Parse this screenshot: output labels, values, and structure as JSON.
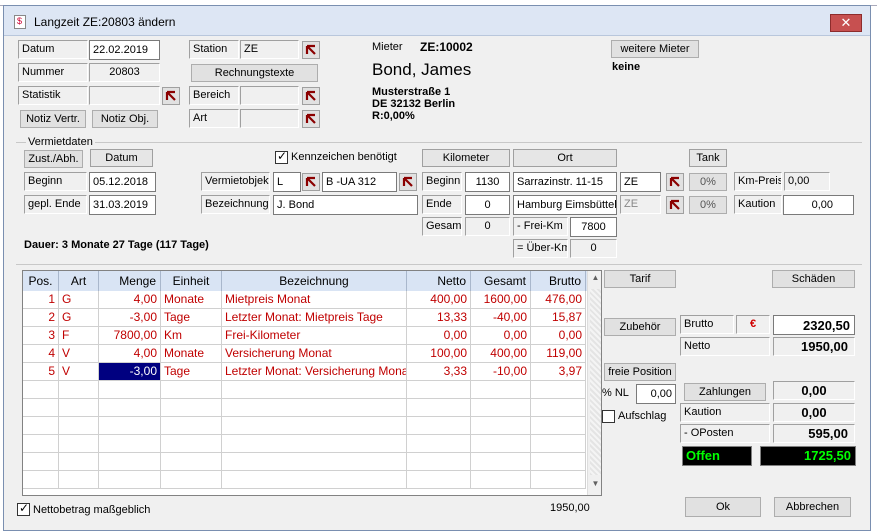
{
  "window": {
    "title": "Langzeit ZE:20803 ändern",
    "close_label": "✕"
  },
  "header": {
    "datum_label": "Datum",
    "datum_value": "22.02.2019",
    "nummer_label": "Nummer",
    "nummer_value": "20803",
    "statistik_label": "Statistik",
    "statistik_value": "",
    "notiz_vertr": "Notiz Vertr.",
    "notiz_obj": "Notiz Obj.",
    "station_label": "Station",
    "station_value": "ZE",
    "rechnungstexte": "Rechnungstexte",
    "bereich_label": "Bereich",
    "bereich_value": "",
    "art_label": "Art",
    "art_value": "",
    "mieter_label": "Mieter",
    "mieter_id": "ZE:10002",
    "mieter_name": "Bond, James",
    "addr1": "Musterstraße 1",
    "addr2": "DE 32132 Berlin",
    "addr3": "R:0,00%",
    "weitere_mieter": "weitere Mieter",
    "weitere_value": "keine"
  },
  "vermietdaten": {
    "title": "Vermietdaten",
    "zust_abh": "Zust./Abh.",
    "datum_hdr": "Datum",
    "beginn_label": "Beginn",
    "beginn_value": "05.12.2018",
    "gepl_ende_label": "gepl. Ende",
    "gepl_ende_value": "31.03.2019",
    "kennzeichen": "Kennzeichen benötigt",
    "vermietobjekt_label": "Vermietobjekt",
    "vo_type": "L",
    "vo_value": "B -UA 312",
    "bezeichnung_label": "Bezeichnung",
    "bezeichnung_value": "J. Bond",
    "km_hdr": "Kilometer",
    "ort_hdr": "Ort",
    "tank_hdr": "Tank",
    "km_beginn_label": "Beginn",
    "km_beginn": "1130",
    "ort_beginn": "Sarrazinstr. 11-15",
    "ort_beginn_code": "ZE",
    "tank_beginn": "0%",
    "km_ende_label": "Ende",
    "km_ende": "0",
    "ort_ende": "Hamburg Eimsbüttel",
    "ort_ende_code": "ZE",
    "tank_ende": "0%",
    "gesamt_label": "Gesamt",
    "gesamt_value": "0",
    "frei_km_label": "- Frei-Km",
    "frei_km_value": "7800",
    "ueber_km_label": "= Über-Km",
    "ueber_km_value": "0",
    "km_preis_label": "Km-Preis",
    "km_preis_value": "0,00",
    "kaution_label": "Kaution",
    "kaution_value": "0,00",
    "dauer": "Dauer: 3 Monate 27 Tage  (117 Tage)"
  },
  "grid": {
    "columns": [
      "Pos.",
      "Art",
      "Menge",
      "Einheit",
      "Bezeichnung",
      "Netto",
      "Gesamt",
      "Brutto"
    ],
    "rows": [
      [
        "1",
        "G",
        "4,00",
        "Monate",
        "Mietpreis Monat",
        "400,00",
        "1600,00",
        "476,00"
      ],
      [
        "2",
        "G",
        "-3,00",
        "Tage",
        "Letzter Monat: Mietpreis Tage",
        "13,33",
        "-40,00",
        "15,87"
      ],
      [
        "3",
        "F",
        "7800,00",
        "Km",
        "Frei-Kilometer",
        "0,00",
        "0,00",
        "0,00"
      ],
      [
        "4",
        "V",
        "4,00",
        "Monate",
        "Versicherung Monat",
        "100,00",
        "400,00",
        "119,00"
      ],
      [
        "5",
        "V",
        "-3,00",
        "Tage",
        "Letzter Monat: Versicherung Monat",
        "3,33",
        "-10,00",
        "3,97"
      ]
    ],
    "empty_rows": 6
  },
  "right": {
    "tarif": "Tarif",
    "schaeden": "Schäden",
    "zubehoer": "Zubehör",
    "brutto_label": "Brutto",
    "euro": "€",
    "brutto_value": "2320,50",
    "netto_label": "Netto",
    "netto_value": "1950,00",
    "freie_position": "freie Position",
    "nl_label": "% NL",
    "nl_value": "0,00",
    "aufschlag": "Aufschlag",
    "zahlungen": "Zahlungen",
    "zahlungen_value": "0,00",
    "kaution_label": "Kaution",
    "kaution_value": "0,00",
    "oposten_label": "- OPosten",
    "oposten_value": "595,00",
    "status": "Offen",
    "status_value": "1725,50"
  },
  "footer": {
    "netto_massgeblich": "Nettobetrag maßgeblich",
    "sum": "1950,00",
    "ok": "Ok",
    "abbrechen": "Abbrechen"
  }
}
